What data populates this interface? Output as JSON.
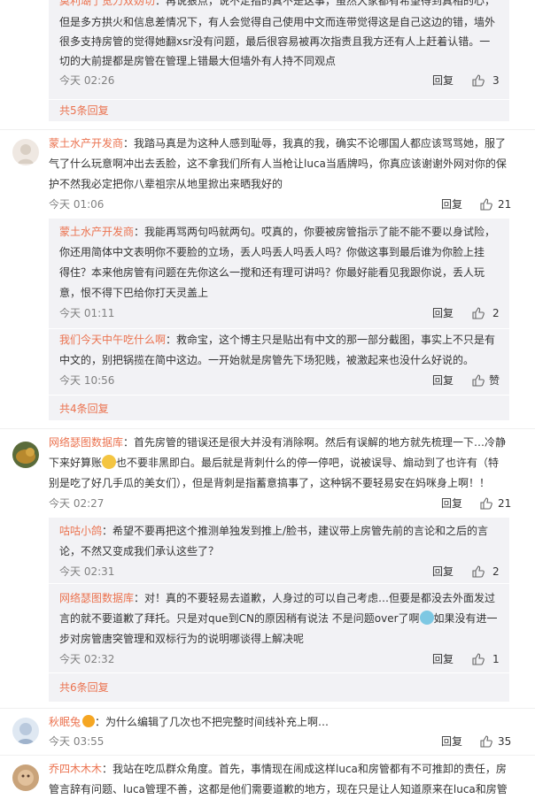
{
  "thread1": {
    "reply1": {
      "cut_user": "莫利瑚了宽力双妫切",
      "lines": [
        "：再说狠点，说不定指的真不是这事，虽然大家都有希望得到真相的心，",
        "但是多方拱火和信息差情况下，有人会觉得自己使用中文而连带觉得这是自己这边的错，墙外",
        "很多支持房管的觉得她翻xsr没有问题，最后很容易被再次指责且我方还有人上赶着认错。一",
        "切的大前提都是房管在管理上错最大但墙外有人持不同观点"
      ],
      "time": "今天 02:26",
      "reply": "回复",
      "likes": "3"
    },
    "more": "共5条回复"
  },
  "c1": {
    "user": "蒙土水产开发商",
    "lines": [
      "：我踏马真是为这种人感到耻辱，我真的我，确实不论哪国人都应该骂骂她，服了",
      "气了什么玩意啊冲出去丢脸，这不拿我们所有人当枪让luca当盾牌吗，你真应该谢谢外网对你的保",
      "护不然我必定把你八辈祖宗从地里掀出来晒我好的"
    ],
    "time": "今天 01:06",
    "reply": "回复",
    "likes": "21",
    "r1": {
      "user": "蒙土水产开发商",
      "lines": [
        "：我能再骂两句吗就两句。哎真的，你要被房管指示了能不能不要以身试险，",
        "你还用简体中文表明你不要脸的立场，丢人吗丢人吗丢人吗？你做这事到最后谁为你脸上挂",
        "得住？本来他房管有问题在先你这么一搅和还有理可讲吗？你最好能看见我跟你说，丢人玩",
        "意，恨不得下巴给你打天灵盖上"
      ],
      "time": "今天 01:11",
      "reply": "回复",
      "likes": "2"
    },
    "r2": {
      "user": "我们今天中午吃什么啊",
      "lines": [
        "：救命宝，这个博主只是贴出有中文的那一部分截图，事实上不只是有",
        "中文的，别把锅揽在简中这边。一开始就是房管先下场犯贱，被激起来也没什么好说的。"
      ],
      "time": "今天 10:56",
      "reply": "回复",
      "likes": "赞"
    },
    "more": "共4条回复"
  },
  "c2": {
    "user": "网络瑟图数据库",
    "lines": [
      "：首先房管的错误还是很大并没有消除啊。然后有误解的地方就先梳理一下…冷静",
      "下来好算账",
      "也不要非黑即白。最后就是背刺什么的停一停吧，说被误导、煽动到了也许有（特",
      "别是吃了好几手瓜的美女们），但是背刺是指蓄意搞事了，这种锅不要轻易安在妈咪身上啊！！"
    ],
    "time": "今天 02:27",
    "reply": "回复",
    "likes": "21",
    "r1": {
      "user": "咕咕小鸽",
      "lines": [
        "：希望不要再把这个推测单独发到推上/脸书，建议带上房管先前的言论和之后的言",
        "论，不然又变成我们承认这些了？"
      ],
      "time": "今天 02:31",
      "reply": "回复",
      "likes": "2"
    },
    "r2": {
      "user": "网络瑟图数据库",
      "lines": [
        "：对！真的不要轻易去道歉，人身过的可以自己考虑…但要是都没去外面发过",
        "言的就不要道歉了拜托。只是对que到CN的原因稍有说法 不是问题over了啊",
        "如果没有进一",
        "步对房管唐突管理和双标行为的说明哪谈得上解决呢"
      ],
      "time": "今天 02:32",
      "reply": "回复",
      "likes": "1"
    },
    "more": "共6条回复"
  },
  "c3": {
    "user": "秋眠兔",
    "text": "：为什么编辑了几次也不把完整时间线补充上啊…",
    "time": "今天 03:55",
    "reply": "回复",
    "likes": "35"
  },
  "c4": {
    "user": "乔四木木木",
    "lines": [
      "：我站在吃瓜群众角度。首先，事情现在闹成这样luca和房管都有不可推卸的责任，房",
      "管言辞有问题、luca管理不善，这都是他们需要道歉的地方，现在只是让人知道原来在luca和房管"
    ]
  }
}
